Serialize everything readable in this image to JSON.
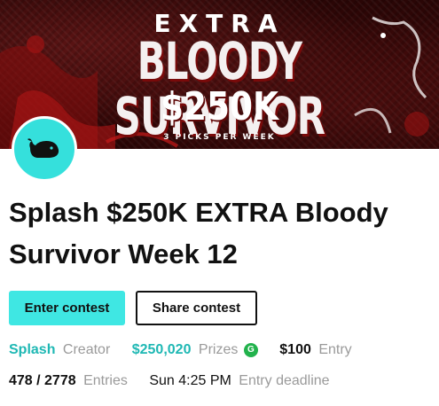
{
  "banner": {
    "extra": "EXTRA",
    "title": "BLOODY SURVIVOR",
    "amount": "$250K",
    "subtitle": "3 PICKS PER WEEK"
  },
  "avatar": {
    "icon": "whale-icon",
    "color": "#35e0dc"
  },
  "contest": {
    "title": "Splash $250K EXTRA Bloody Survivor Week 12"
  },
  "actions": {
    "enter_label": "Enter contest",
    "share_label": "Share contest"
  },
  "meta": {
    "creator_name": "Splash",
    "creator_label": "Creator",
    "prizes_value": "$250,020",
    "prizes_label": "Prizes",
    "prizes_badge": "G",
    "entry_value": "$100",
    "entry_label": "Entry",
    "entries_value": "478 / 2778",
    "entries_label": "Entries",
    "deadline_value": "Sun 4:25 PM",
    "deadline_label": "Entry deadline"
  },
  "colors": {
    "accent": "#3fe7e3",
    "accent_text": "#1fb8b4",
    "badge_green": "#22b24c",
    "banner_red": "#3b0909"
  }
}
